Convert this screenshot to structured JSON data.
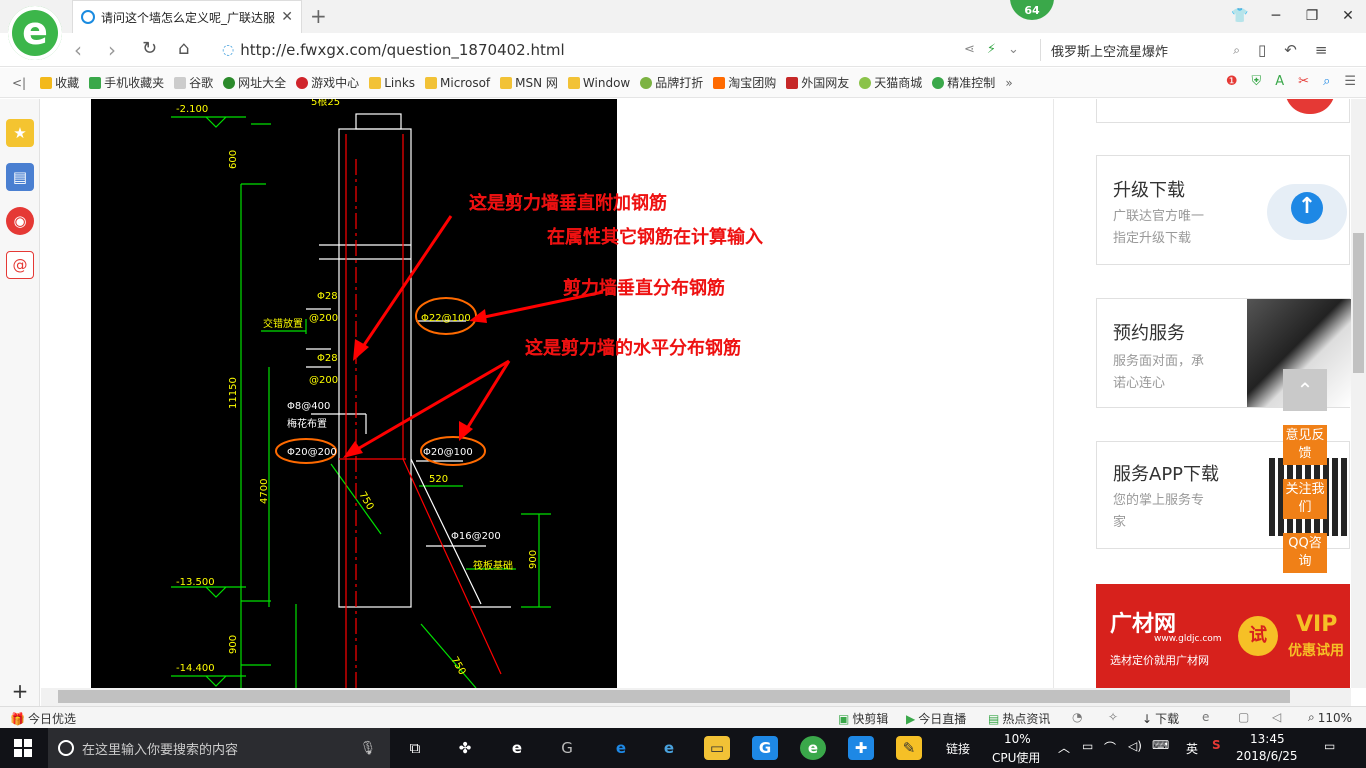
{
  "browser": {
    "tab_title": "请问这个墙怎么定义呢_广联达服",
    "badge": "64",
    "url": "http://e.fwxgx.com/question_1870402.html",
    "search_query": "俄罗斯上空流星爆炸",
    "logo_letter": "e"
  },
  "bookmarks": [
    {
      "label": "收藏",
      "color": "#f3b91b"
    },
    {
      "label": "手机收藏夹",
      "color": "#3aa84a"
    },
    {
      "label": "谷歌",
      "color": "#888888"
    },
    {
      "label": "网址大全",
      "color": "#2c8b2c"
    },
    {
      "label": "游戏中心",
      "color": "#d0242b"
    },
    {
      "label": "Links",
      "color": "#f2c236"
    },
    {
      "label": "Microsof",
      "color": "#f2c236"
    },
    {
      "label": "MSN 网",
      "color": "#f2c236"
    },
    {
      "label": "Window",
      "color": "#f2c236"
    },
    {
      "label": "品牌打折",
      "color": "#7cb342"
    },
    {
      "label": "淘宝团购",
      "color": "#ff6a00"
    },
    {
      "label": "外国网友",
      "color": "#c62828"
    },
    {
      "label": "天猫商城",
      "color": "#8bc34a"
    },
    {
      "label": "精准控制",
      "color": "#3aa84a"
    }
  ],
  "drawing": {
    "annotations": {
      "a1": "这是剪力墙垂直附加钢筋",
      "a2": "在属性其它钢筋在计算输入",
      "a3": "剪力墙垂直分布钢筋",
      "a4": "这是剪力墙的水平分布钢筋"
    },
    "levels": {
      "l1": "-2.100",
      "l2": "-13.500",
      "l3": "-14.400"
    },
    "dims": {
      "d600": "600",
      "d11150": "11150",
      "d4700": "4700",
      "d900": "900",
      "d900b": "900",
      "d520": "520",
      "d750": "750",
      "d150": "750"
    },
    "labels": {
      "top": "5根25",
      "phi28a": "Φ28",
      "at200a": "@200",
      "jiaocuo": "交错放置",
      "phi28b": "Φ28",
      "at200b": "@200",
      "phi8": "Φ8@400",
      "meihua": "梅花布置",
      "phi20a": "Φ20@200",
      "phi22": "Φ22@100",
      "phi20b": "Φ20@100",
      "phi16": "Φ16@200",
      "raft": "筏板基础"
    }
  },
  "right_panel": {
    "card1": {
      "title": "升级下载",
      "sub1": "广联达官方唯一",
      "sub2": "指定升级下载"
    },
    "card2": {
      "title": "预约服务",
      "sub1": "服务面对面，承",
      "sub2": "诺心连心"
    },
    "card3": {
      "title": "服务APP下载",
      "sub1": "您的掌上服务专",
      "sub2": "家"
    },
    "promo": {
      "brand": "广材网",
      "site": "www.gldjc.com",
      "slogan": "选材定价就用广材网",
      "trial": "试",
      "vip": "VIP",
      "vip_sub": "优惠试用"
    },
    "float": {
      "feedback": "意见反馈",
      "follow": "关注我们",
      "qq": "QQ咨询"
    }
  },
  "statusbar": {
    "left": "今日优选",
    "kuaijianji": "快剪辑",
    "zhibo": "今日直播",
    "redian": "热点资讯",
    "download": "下载",
    "zoom": "110%"
  },
  "taskbar": {
    "search_placeholder": "在这里输入你要搜索的内容",
    "link": "链接",
    "cpu_pct": "10%",
    "cpu_label": "CPU使用",
    "ime": "英",
    "time": "13:45",
    "date": "2018/6/25"
  }
}
